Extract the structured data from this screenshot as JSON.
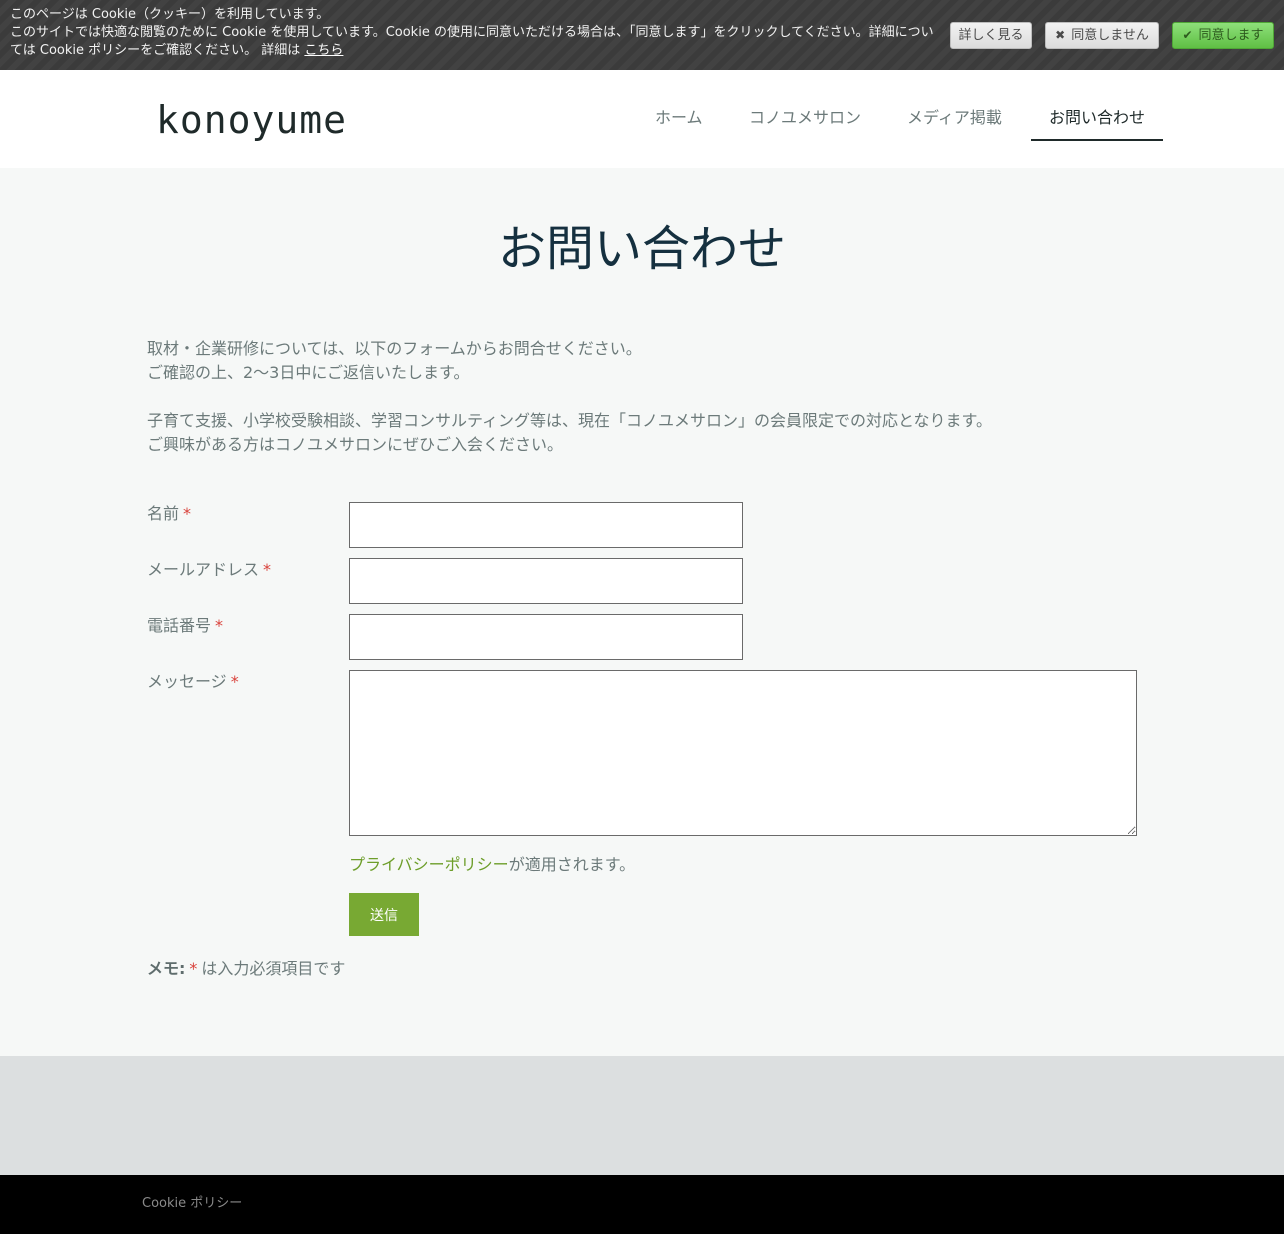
{
  "cookie_banner": {
    "line1": "このページは Cookie（クッキー）を利用しています。",
    "line2": "このサイトでは快適な閲覧のために Cookie を使用しています。Cookie の使用に同意いただける場合は、「同意します」をクリックしてください。詳細につい",
    "line3_prefix": "ては Cookie ポリシーをご確認ください。 詳細は",
    "details_link": "こちら",
    "more_button": "詳しく見る",
    "reject_button": "同意しません",
    "accept_button": "同意します"
  },
  "header": {
    "logo": "konoyume",
    "nav": [
      {
        "label": "ホーム",
        "active": false
      },
      {
        "label": "コノユメサロン",
        "active": false
      },
      {
        "label": "メディア掲載",
        "active": false
      },
      {
        "label": "お問い合わせ",
        "active": true
      }
    ]
  },
  "main": {
    "title": "お問い合わせ",
    "intro": {
      "p1_line1": "取材・企業研修については、以下のフォームからお問合せください。",
      "p1_line2": "ご確認の上、2～3日中にご返信いたします。",
      "p2_line1": "子育て支援、小学校受験相談、学習コンサルティング等は、現在「コノユメサロン」の会員限定での対応となります。",
      "p2_line2": "ご興味がある方はコノユメサロンにぜひご入会ください。"
    },
    "form": {
      "required_mark": "*",
      "name_label": "名前",
      "name_value": "",
      "email_label": "メールアドレス",
      "email_value": "",
      "phone_label": "電話番号",
      "phone_value": "",
      "message_label": "メッセージ",
      "message_value": "",
      "privacy_link": "プライバシーポリシー",
      "privacy_suffix": "が適用されます。",
      "submit_label": "送信",
      "memo_label": "メモ:",
      "memo_text": "は入力必須項目です"
    }
  },
  "footer": {
    "cookie_policy_link": "Cookie ポリシー"
  },
  "colors": {
    "accent_green": "#78a933",
    "link_green": "#6d9e2a",
    "required_red": "#d9413a",
    "title_navy": "#15303f"
  }
}
